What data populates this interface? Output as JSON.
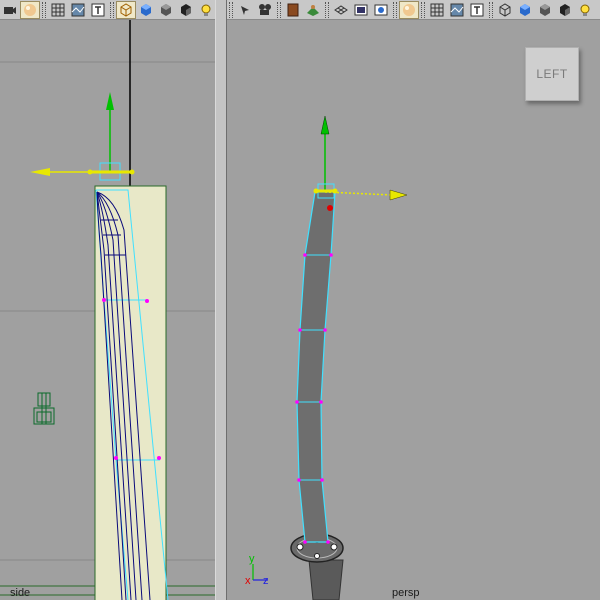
{
  "viewports": {
    "side": {
      "label": "side"
    },
    "persp": {
      "label": "persp"
    }
  },
  "view_cube": {
    "label": "LEFT"
  },
  "axis_triad": {
    "y_label": "y",
    "x_label": "x",
    "z_label": "z"
  },
  "toolbar_left": {
    "icons": [
      "camera-icon",
      "sphere-shaded-icon",
      "wireframe-grid-icon",
      "texture-icon",
      "text-icon",
      "wireframe-cube-icon",
      "smooth-shade-cube-icon",
      "flat-shade-cube-icon",
      "lights-cube-icon",
      "light-bulb-icon"
    ]
  },
  "toolbar_right": {
    "icons": [
      "select-camera-icon",
      "film-camera-icon",
      "bookmark-icon",
      "image-plane-icon",
      "grid-icon",
      "resolution-gate-icon",
      "film-gate-icon",
      "sphere-shaded-icon",
      "wireframe-grid-icon",
      "texture-icon",
      "text-icon",
      "wireframe-cube-icon",
      "smooth-shade-cube-icon",
      "flat-shade-cube-icon",
      "lights-cube-icon",
      "light-bulb-icon"
    ]
  },
  "colors": {
    "viewport_bg": "#a0a0a0",
    "wire": "#0a0a7a",
    "selection": "#40e0ff",
    "manip_y": "#00c000",
    "manip_x": "#e8e800",
    "vertex": "#ff00ff",
    "image_plane": "#e8e8c8"
  }
}
